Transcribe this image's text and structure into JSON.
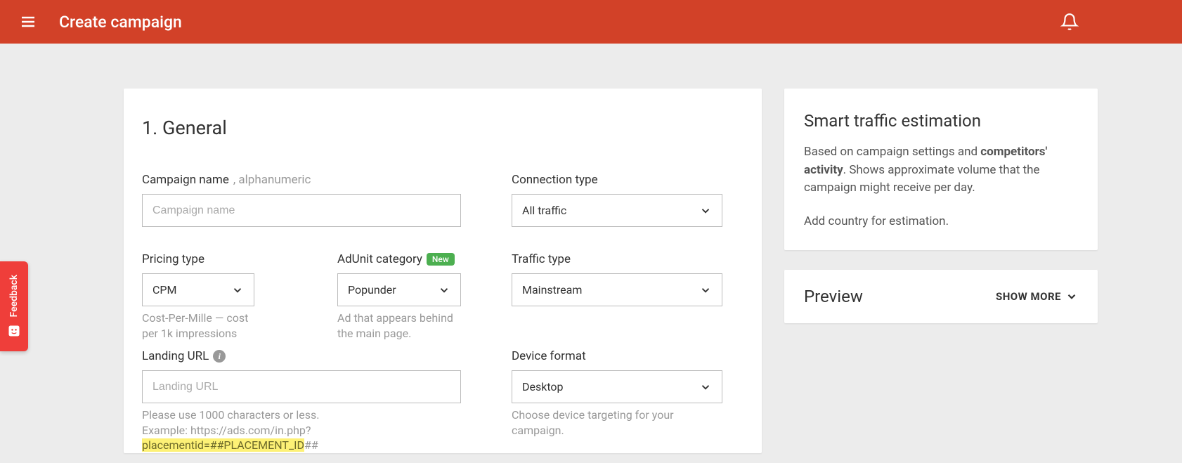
{
  "header": {
    "title": "Create campaign"
  },
  "section": {
    "title": "1. General"
  },
  "fields": {
    "campaign_name": {
      "label": "Campaign name",
      "hint": ", alphanumeric",
      "placeholder": "Campaign name"
    },
    "connection_type": {
      "label": "Connection type",
      "value": "All traffic"
    },
    "pricing_type": {
      "label": "Pricing type",
      "value": "CPM",
      "help": "Cost-Per-Mille — cost per 1k impressions"
    },
    "adunit_category": {
      "label": "AdUnit category",
      "badge": "New",
      "value": "Popunder",
      "help": "Ad that appears behind the main page."
    },
    "traffic_type": {
      "label": "Traffic type",
      "value": "Mainstream"
    },
    "landing_url": {
      "label": "Landing URL",
      "placeholder": "Landing URL",
      "help_1": "Please use 1000 characters or less.",
      "help_2a": "Example: https://ads.com/in.php?",
      "help_2b": "placementid=##PLACEMENT_ID",
      "help_2c": "##"
    },
    "device_format": {
      "label": "Device format",
      "value": "Desktop",
      "help": "Choose device targeting for your campaign."
    }
  },
  "sidebar": {
    "estimation": {
      "title": "Smart traffic estimation",
      "text_1": "Based on campaign settings and ",
      "text_strong": "competitors' activity",
      "text_2": ". Shows approximate volume that the campaign might receive per day.",
      "text_3": "Add country for estimation."
    },
    "preview": {
      "title": "Preview",
      "show_more": "SHOW MORE"
    }
  },
  "feedback": {
    "label": "Feedback"
  }
}
